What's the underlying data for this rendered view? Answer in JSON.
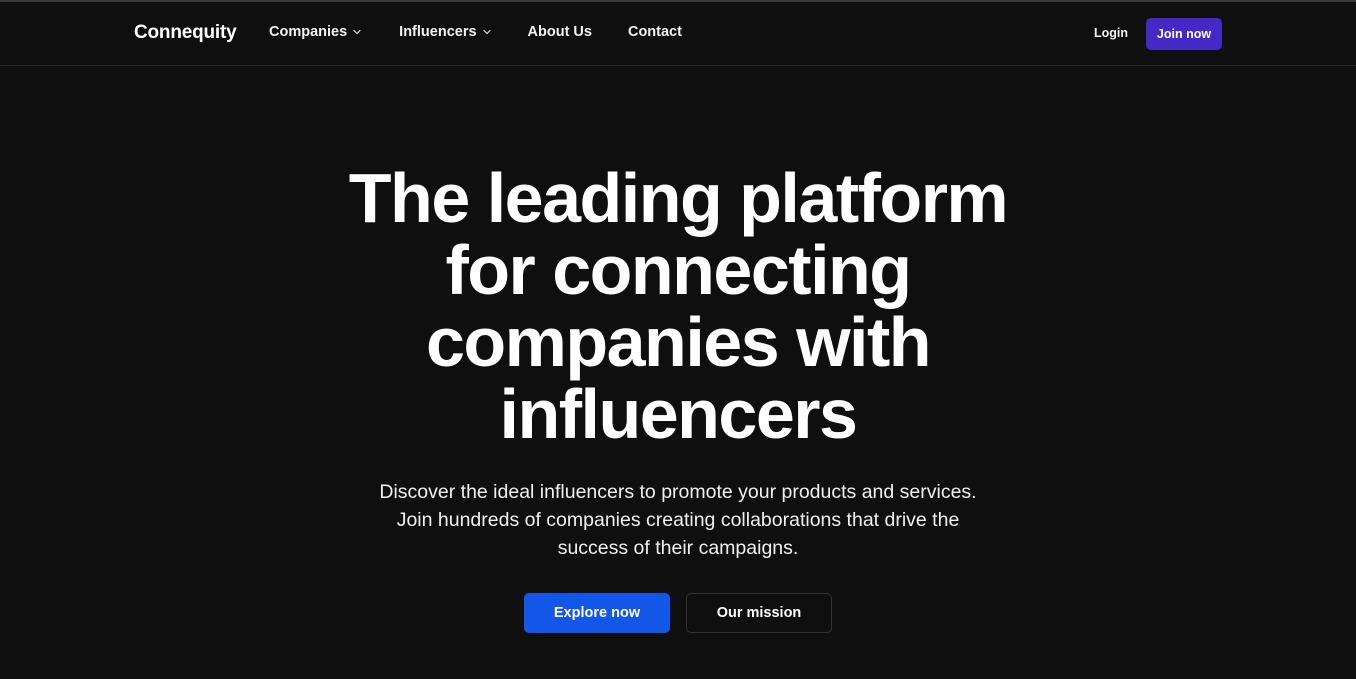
{
  "nav": {
    "logo": "Connequity",
    "links": [
      {
        "label": "Companies",
        "has_dropdown": true
      },
      {
        "label": "Influencers",
        "has_dropdown": true
      },
      {
        "label": "About Us",
        "has_dropdown": false
      },
      {
        "label": "Contact",
        "has_dropdown": false
      }
    ],
    "login": "Login",
    "join": "Join now",
    "dropdown_icon": "chevron-down-icon"
  },
  "hero": {
    "title_lines": [
      "The leading platform",
      "for connecting",
      "companies with",
      "influencers"
    ],
    "subtitle_lines": [
      "Discover the ideal influencers to promote your products and services.",
      "Join hundreds of companies creating collaborations that drive the",
      "success of their campaigns."
    ],
    "primary_cta": "Explore now",
    "secondary_cta": "Our mission"
  },
  "colors": {
    "background": "#0f0f0f",
    "join_button": "#4429c7",
    "primary_button": "#1257e8",
    "text": "#ffffff"
  }
}
